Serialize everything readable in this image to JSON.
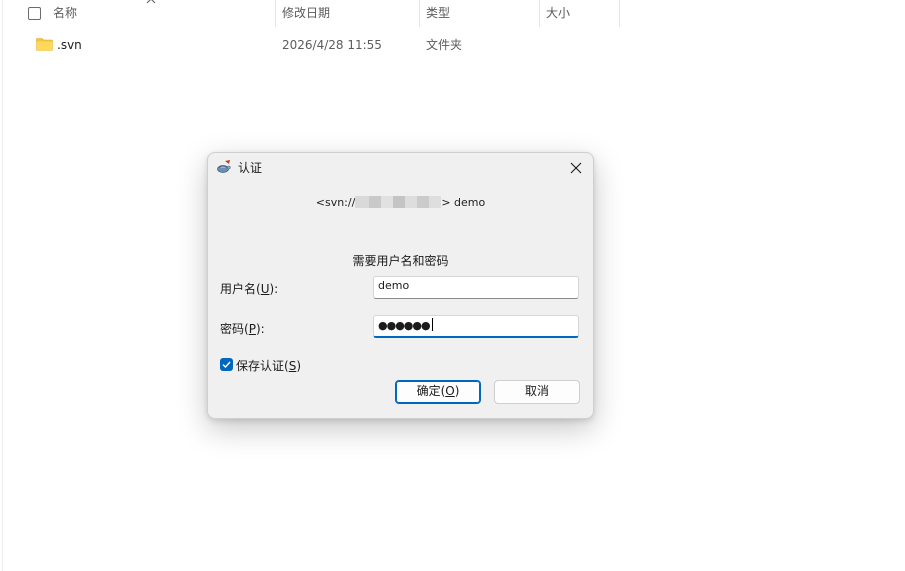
{
  "explorer": {
    "columns": [
      "名称",
      "修改日期",
      "类型",
      "大小"
    ],
    "rows": [
      {
        "name": ".svn",
        "date": "2026/4/28 11:55",
        "type": "文件夹",
        "size": ""
      }
    ]
  },
  "dialog": {
    "title": "认证",
    "realm_prefix": "<svn://",
    "realm_suffix": "> demo",
    "prompt": "需要用户名和密码",
    "username_label": "用户名(",
    "username_key": "U",
    "username_label_end": "):",
    "username_value": "demo",
    "password_label": "密码(",
    "password_key": "P",
    "password_label_end": "):",
    "password_mask": "●●●●●●",
    "save_auth_label": "保存认证(",
    "save_auth_key": "S",
    "save_auth_end": ")",
    "save_auth_checked": true,
    "ok_label": "确定(",
    "ok_key": "O",
    "ok_end": ")",
    "cancel_label": "取消"
  },
  "colors": {
    "accent": "#0067c0",
    "folder": "#f5c542"
  }
}
